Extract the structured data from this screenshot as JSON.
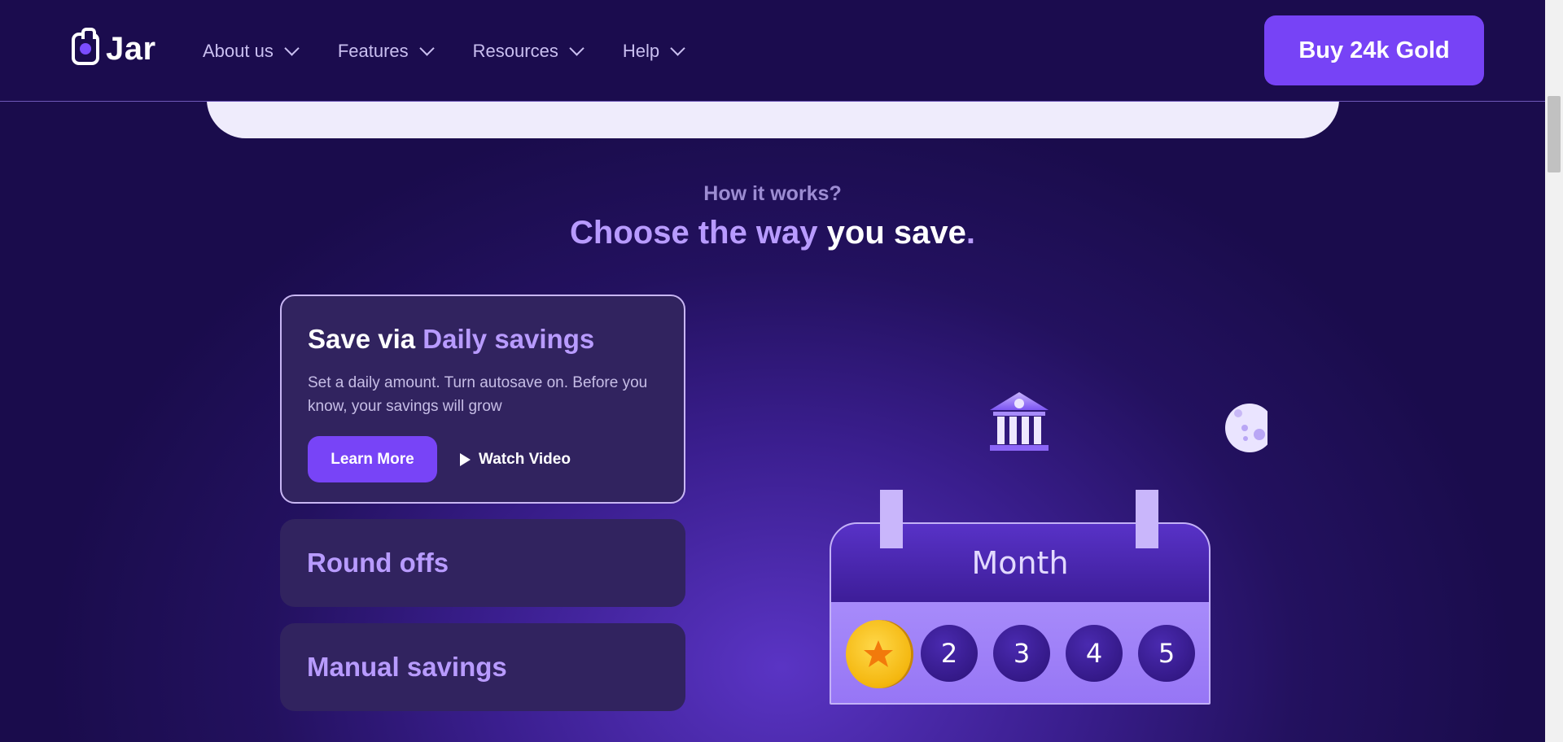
{
  "brand": {
    "name": "Jar"
  },
  "nav": {
    "items": [
      {
        "label": "About us"
      },
      {
        "label": "Features"
      },
      {
        "label": "Resources"
      },
      {
        "label": "Help"
      }
    ],
    "cta_label": "Buy 24k Gold"
  },
  "section": {
    "eyebrow": "How it works?",
    "title_part1": "Choose the way",
    "title_part2": " you save",
    "title_part3": "."
  },
  "cards": {
    "active": {
      "title_prefix": "Save via ",
      "title_accent": "Daily savings",
      "description": "Set a daily amount. Turn autosave on. Before you know, your savings will grow",
      "learn_more_label": "Learn More",
      "watch_video_label": "Watch Video"
    },
    "round_offs": {
      "title": "Round offs"
    },
    "manual": {
      "title": "Manual savings"
    }
  },
  "calendar": {
    "header": "Month",
    "days": [
      "2",
      "3",
      "4",
      "5"
    ]
  },
  "colors": {
    "accent": "#7743f6",
    "accent_text": "#b89bff",
    "header_bg": "#1b0c4e",
    "card_bg": "#31235f"
  },
  "icons": [
    "jar-logo-icon",
    "chevron-down-icon",
    "play-icon",
    "bank-icon",
    "moon-icon",
    "gold-coin-star-icon"
  ]
}
